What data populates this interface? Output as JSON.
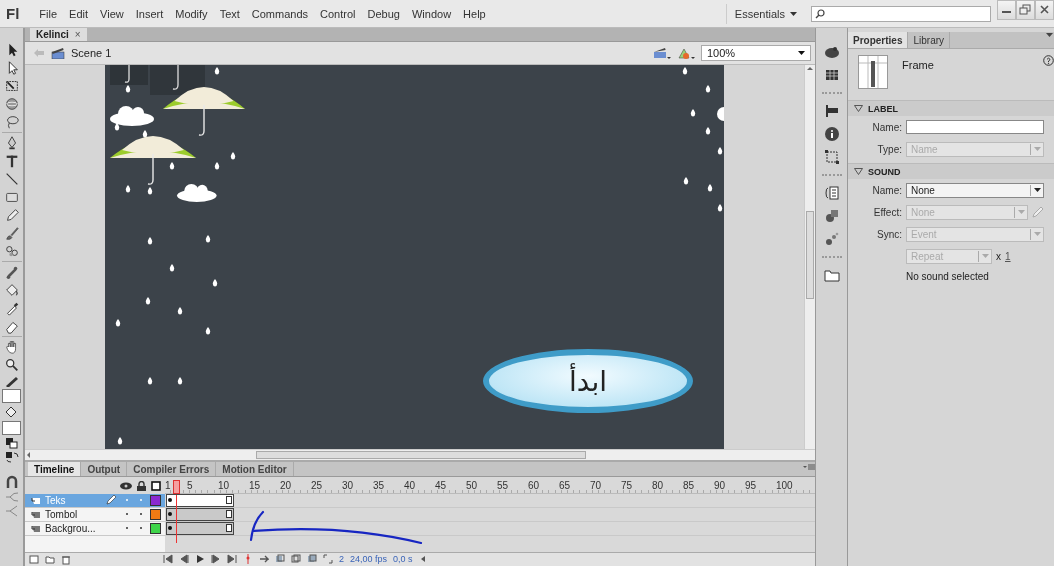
{
  "app": {
    "logo": "Fl",
    "menu": [
      "File",
      "Edit",
      "View",
      "Insert",
      "Modify",
      "Text",
      "Commands",
      "Control",
      "Debug",
      "Window",
      "Help"
    ],
    "workspace": "Essentials"
  },
  "document_tabs": [
    {
      "label": "Kelinci",
      "close": "×",
      "selected": true
    }
  ],
  "scene": {
    "label": "Scene 1",
    "zoom": "100%"
  },
  "stage": {
    "button_text": "ابدأ"
  },
  "timeline": {
    "tabs": [
      {
        "label": "Timeline",
        "selected": true
      },
      {
        "label": "Output",
        "selected": false
      },
      {
        "label": "Compiler Errors",
        "selected": false
      },
      {
        "label": "Motion Editor",
        "selected": false
      }
    ],
    "ruler": [
      "1",
      "5",
      "10",
      "15",
      "20",
      "25",
      "30",
      "35",
      "40",
      "45",
      "50",
      "55",
      "60",
      "65",
      "70",
      "75",
      "80",
      "85",
      "90",
      "95",
      "100"
    ],
    "layers": [
      {
        "name": "Teks",
        "selected": true,
        "editing": true,
        "color": "#8a2ad0"
      },
      {
        "name": "Tombol",
        "selected": false,
        "editing": false,
        "color": "#f07a14"
      },
      {
        "name": "Backgrou...",
        "selected": false,
        "editing": false,
        "color": "#3fd44a"
      }
    ],
    "current_frame": "2",
    "fps": "24,00 fps",
    "elapsed": "0,0 s"
  },
  "properties": {
    "tabs": [
      {
        "label": "Properties",
        "selected": true
      },
      {
        "label": "Library",
        "selected": false
      }
    ],
    "object": "Frame",
    "sections": [
      {
        "title": "LABEL",
        "expanded": true,
        "rows": [
          {
            "kind": "text",
            "label": "Name:"
          },
          {
            "kind": "select",
            "label": "Type:",
            "value": "Name",
            "disabled": true
          }
        ]
      },
      {
        "title": "SOUND",
        "expanded": true,
        "rows": [
          {
            "kind": "select",
            "label": "Name:",
            "value": "None",
            "disabled": false
          },
          {
            "kind": "select",
            "label": "Effect:",
            "value": "None",
            "disabled": true,
            "edit_button": true
          },
          {
            "kind": "select",
            "label": "Sync:",
            "value": "Event",
            "disabled": true
          },
          {
            "kind": "repeat",
            "value": "Repeat",
            "disabled": true,
            "times_sign": "x",
            "count": "1"
          },
          {
            "kind": "note",
            "text": "No sound selected"
          }
        ]
      }
    ]
  }
}
